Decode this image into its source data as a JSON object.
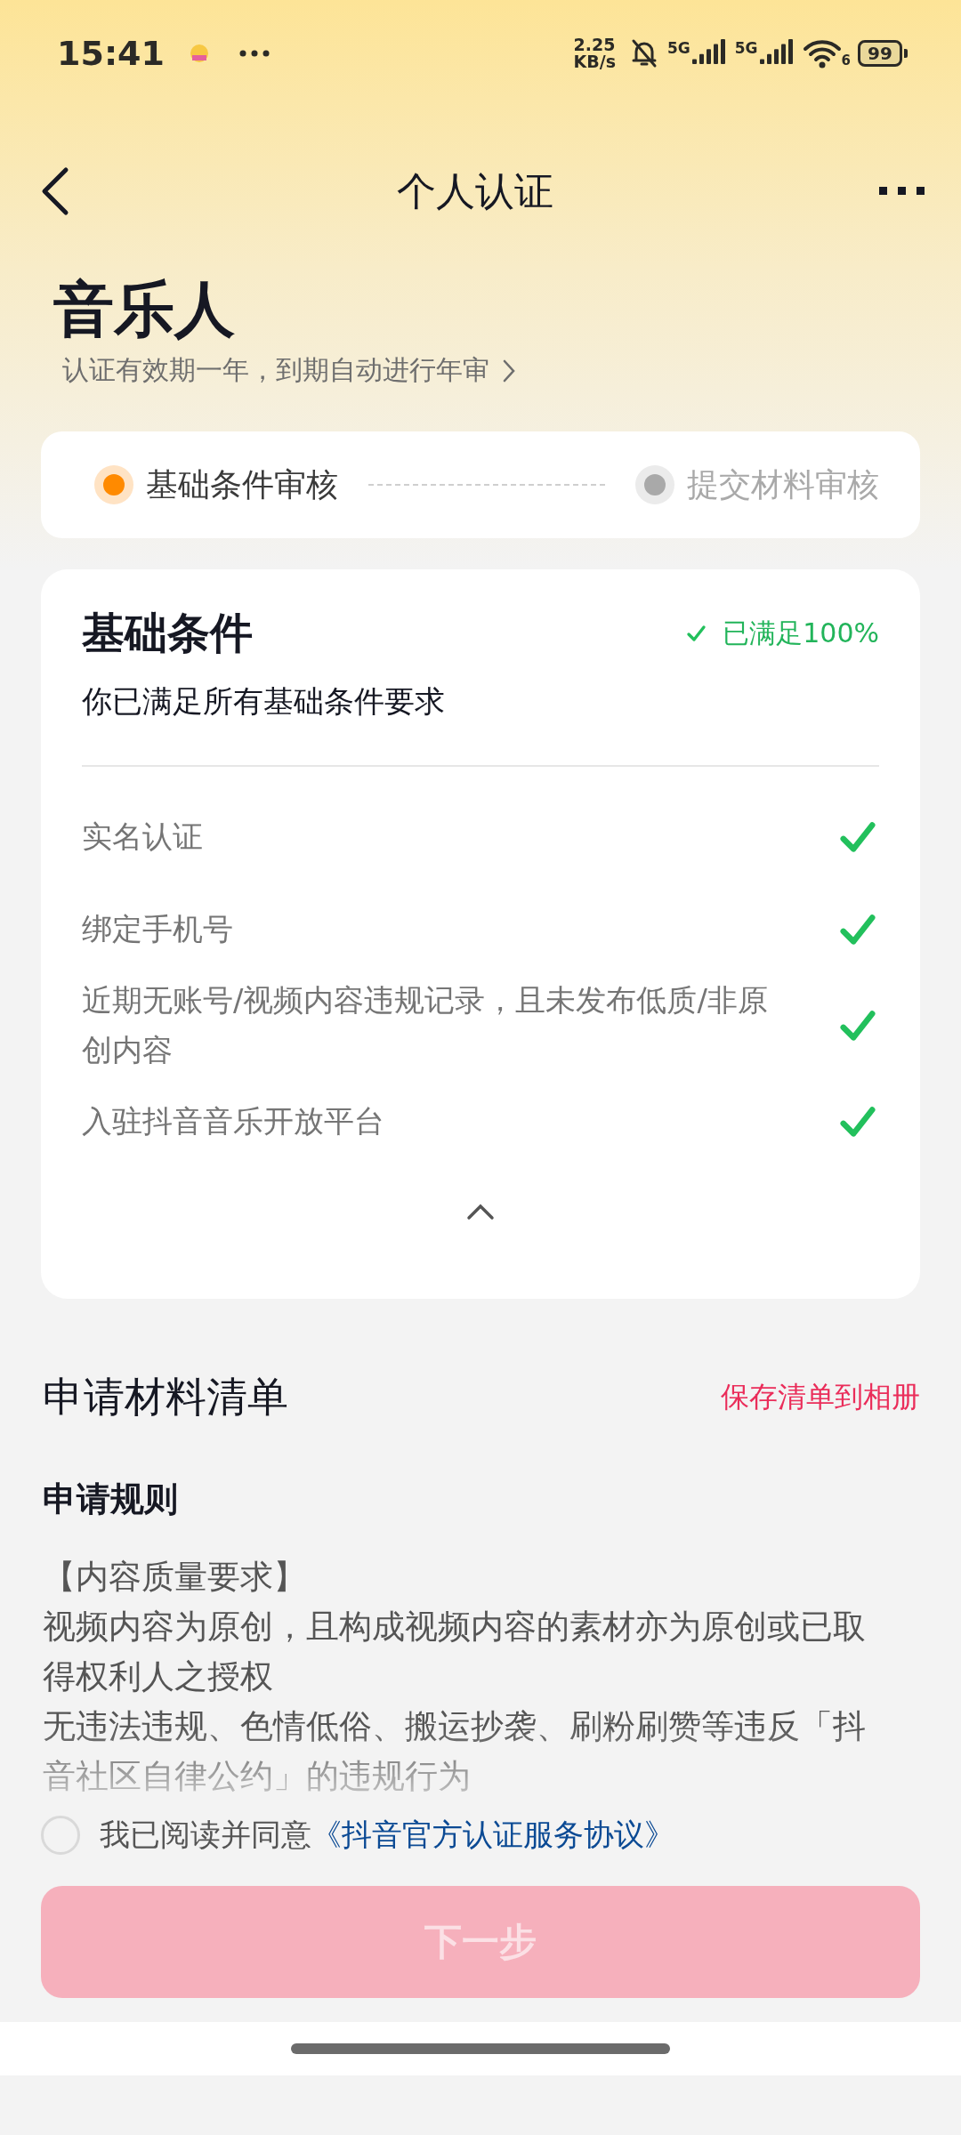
{
  "status_bar": {
    "time": "15:41",
    "network_speed": "2.25",
    "network_unit": "KB/s",
    "sim_labels": [
      "5G",
      "5G"
    ],
    "wifi_label": "6",
    "battery": "99"
  },
  "header": {
    "title": "个人认证"
  },
  "intro": {
    "title": "音乐人",
    "subtitle": "认证有效期一年，到期自动进行年审"
  },
  "steps": [
    {
      "label": "基础条件审核",
      "selected": true
    },
    {
      "label": "提交材料审核",
      "selected": false
    }
  ],
  "conditions": {
    "title": "基础条件",
    "status": "已满足100%",
    "summary": "你已满足所有基础条件要求",
    "expanded": true,
    "items": [
      {
        "label": "实名认证",
        "met": true
      },
      {
        "label": "绑定手机号",
        "met": true
      },
      {
        "label": "近期无账号/视频内容违规记录，且未发布低质/非原创内容",
        "met": true
      },
      {
        "label": "入驻抖音音乐开放平台",
        "met": true
      }
    ]
  },
  "materials": {
    "title": "申请材料清单",
    "save_link": "保存清单到相册"
  },
  "rules": {
    "title": "申请规则",
    "lines": [
      "【内容质量要求】",
      "视频内容为原创，且构成视频内容的素材亦为原创或已取得权利人之授权",
      "无违法违规、色情低俗、搬运抄袭、刷粉刷赞等违反「抖音社区自律公约」的违规行为"
    ]
  },
  "agreement": {
    "checked": false,
    "text": "我已阅读并同意",
    "link": "《抖音官方认证服务协议》"
  },
  "next_button": {
    "label": "下一步",
    "disabled": true
  }
}
